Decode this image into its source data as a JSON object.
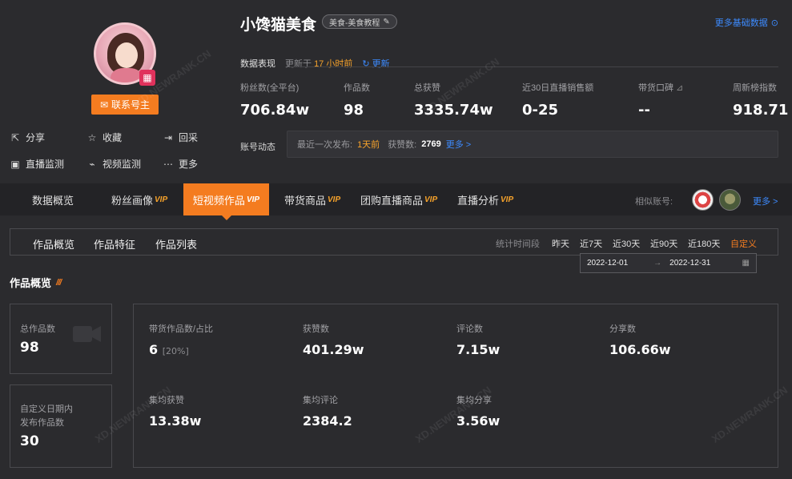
{
  "profile": {
    "name": "小馋猫美食",
    "tag": "美食-美食教程",
    "contact_label": "联系号主",
    "actions": [
      {
        "label": "分享",
        "icon": "share-icon"
      },
      {
        "label": "收藏",
        "icon": "star-icon"
      },
      {
        "label": "回采",
        "icon": "login-icon"
      },
      {
        "label": "直播监测",
        "icon": "tv-icon"
      },
      {
        "label": "视频监测",
        "icon": "chart-icon"
      },
      {
        "label": "更多",
        "icon": "more-icon"
      }
    ]
  },
  "header": {
    "more_basic": "更多基础数据",
    "perf_label": "数据表现",
    "updated_prefix": "更新于",
    "updated_value": "17 小时前",
    "refresh_label": "更新"
  },
  "stats": [
    {
      "label": "粉丝数(全平台)",
      "value": "706.84w"
    },
    {
      "label": "作品数",
      "value": "98"
    },
    {
      "label": "总获赞",
      "value": "3335.74w"
    },
    {
      "label": "近30日直播销售额",
      "value": "0-25"
    },
    {
      "label": "带货口碑",
      "value": "--"
    },
    {
      "label": "周新榜指数",
      "value": "918.71"
    }
  ],
  "dynamics": {
    "label": "账号动态",
    "last_publish_label": "最近一次发布:",
    "last_publish_value": "1天前",
    "likes_label": "获赞数:",
    "likes_value": "2769",
    "more": "更多 >"
  },
  "tabs": [
    {
      "label": "数据概览",
      "vip": ""
    },
    {
      "label": "粉丝画像",
      "vip": "VIP"
    },
    {
      "label": "短视频作品",
      "vip": "VIP"
    },
    {
      "label": "带货商品",
      "vip": "VIP"
    },
    {
      "label": "团购直播商品",
      "vip": "VIP"
    },
    {
      "label": "直播分析",
      "vip": "VIP"
    }
  ],
  "similar": {
    "label": "相似账号:",
    "more": "更多 >"
  },
  "subnav": {
    "tabs": [
      "作品概览",
      "作品特征",
      "作品列表"
    ],
    "range_label": "统计时间段",
    "range_options": [
      "昨天",
      "近7天",
      "近30天",
      "近90天",
      "近180天",
      "自定义"
    ],
    "active_range": "自定义",
    "date_start": "2022-12-01",
    "date_sep": "→",
    "date_end": "2022-12-31"
  },
  "section_title": "作品概览",
  "left_cards": [
    {
      "label": "总作品数",
      "value": "98"
    },
    {
      "label": "自定义日期内\n发布作品数",
      "value": "30"
    }
  ],
  "metrics": [
    {
      "label": "带货作品数/占比",
      "value": "6",
      "sub": "[20%]"
    },
    {
      "label": "获赞数",
      "value": "401.29w"
    },
    {
      "label": "评论数",
      "value": "7.15w"
    },
    {
      "label": "分享数",
      "value": "106.66w"
    },
    {
      "label": "集均获赞",
      "value": "13.38w"
    },
    {
      "label": "集均评论",
      "value": "2384.2"
    },
    {
      "label": "集均分享",
      "value": "3.56w"
    }
  ],
  "watermark": "XD.NEWRANK.CN",
  "colors": {
    "accent": "#f47c20",
    "link": "#3d8bff",
    "highlight": "#f7a32b",
    "bg": "#2b2b2e"
  }
}
